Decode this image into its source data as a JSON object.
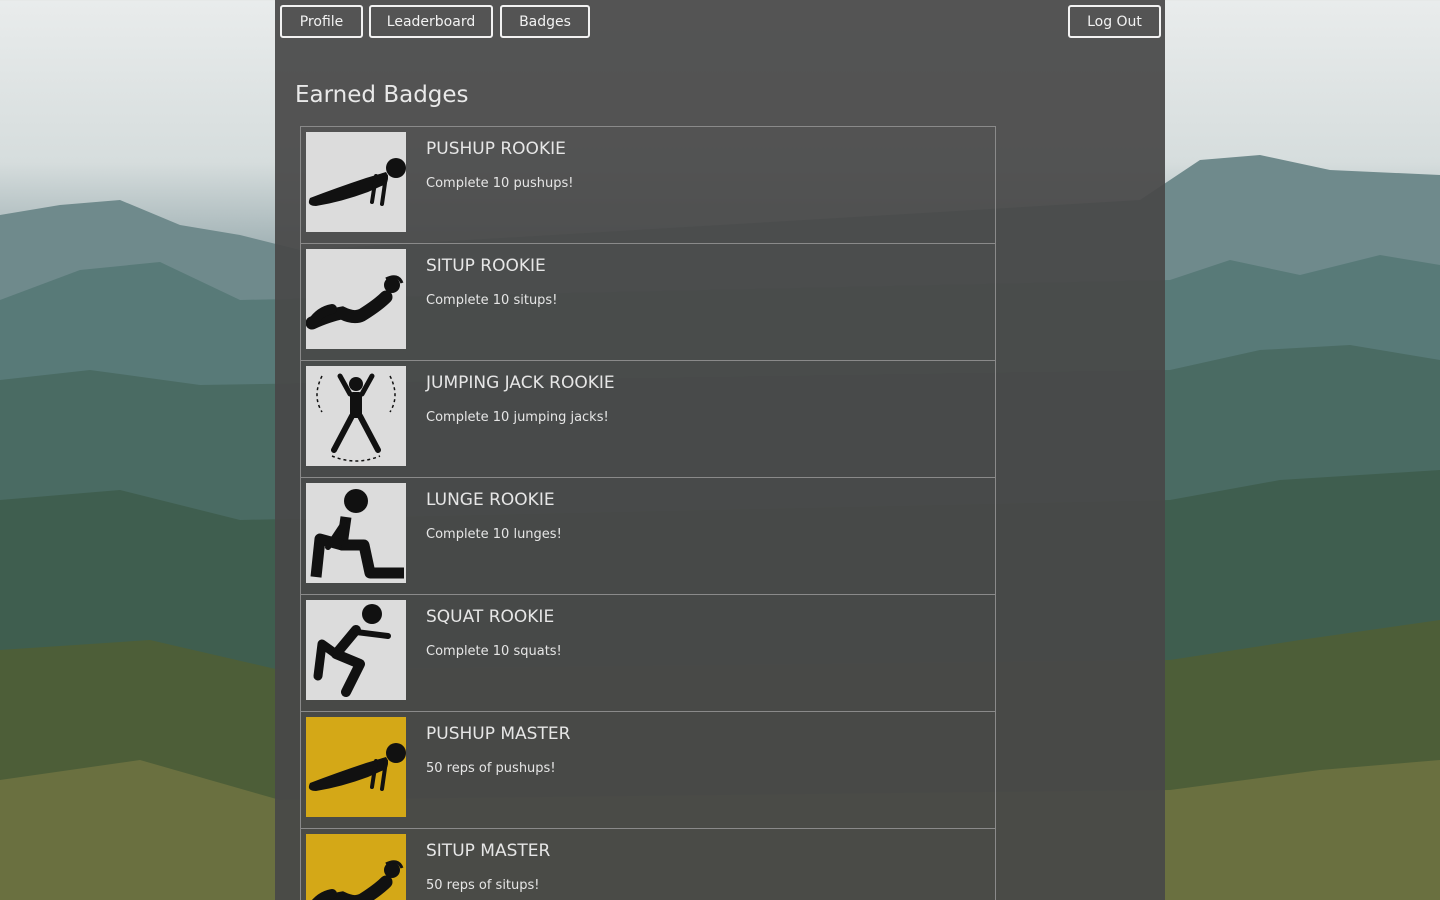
{
  "nav": {
    "profile_label": "Profile",
    "leaderboard_label": "Leaderboard",
    "badges_label": "Badges",
    "logout_label": "Log Out"
  },
  "page_title": "Earned Badges",
  "badges": [
    {
      "name": "PUSHUP ROOKIE",
      "description": "Complete 10 pushups!",
      "icon": "pushup-icon",
      "tier": "rookie"
    },
    {
      "name": "SITUP ROOKIE",
      "description": "Complete 10 situps!",
      "icon": "situp-icon",
      "tier": "rookie"
    },
    {
      "name": "JUMPING JACK ROOKIE",
      "description": "Complete 10 jumping jacks!",
      "icon": "jumping-jack-icon",
      "tier": "rookie"
    },
    {
      "name": "LUNGE ROOKIE",
      "description": "Complete 10 lunges!",
      "icon": "lunge-icon",
      "tier": "rookie"
    },
    {
      "name": "SQUAT ROOKIE",
      "description": "Complete 10 squats!",
      "icon": "squat-icon",
      "tier": "rookie"
    },
    {
      "name": "PUSHUP MASTER",
      "description": "50 reps of pushups!",
      "icon": "pushup-icon",
      "tier": "master"
    },
    {
      "name": "SITUP MASTER",
      "description": "50 reps of situps!",
      "icon": "situp-icon",
      "tier": "master"
    }
  ],
  "colors": {
    "rookie_badge_bg": "#dcdcdc",
    "master_badge_bg": "#d4a817",
    "panel_bg": "#484848",
    "text": "#e6e6e6"
  }
}
